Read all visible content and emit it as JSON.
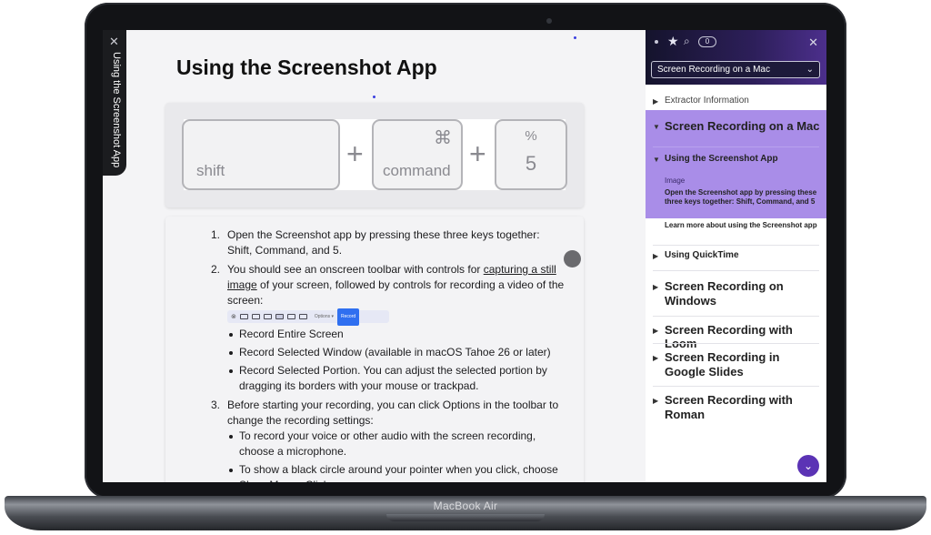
{
  "device": {
    "brand": "MacBook Air"
  },
  "side_tab": {
    "label": "Using the Screenshot App",
    "close_glyph": "✕"
  },
  "document": {
    "title": "Using the Screenshot App",
    "keys": [
      {
        "label": "shift",
        "symbol": ""
      },
      {
        "label": "command",
        "symbol": "⌘"
      },
      {
        "label": "5",
        "symbol": "%"
      }
    ],
    "plus": "+",
    "steps": [
      {
        "num": "1.",
        "text": "Open the Screenshot app by pressing these three keys together: Shift, Command, and 5."
      },
      {
        "num": "2.",
        "text_before": "You should see an onscreen toolbar with controls for ",
        "link": "capturing a still image",
        "text_after": " of your screen, followed by controls for recording a video of the screen:"
      },
      {
        "num": "3.",
        "text": "Before starting your recording, you can click Options in the toolbar to change the recording settings:"
      }
    ],
    "toolbar_mini": {
      "options_label": "Options ▾",
      "record_label": "Record"
    },
    "step2_bullets": [
      "Record Entire Screen",
      "Record Selected Window (available in macOS Tahoe 26 or later)",
      "Record Selected Portion. You can adjust the selected portion by dragging its borders with your mouse or trackpad."
    ],
    "step3_bullets": [
      "To record your voice or other audio with the screen recording, choose a microphone.",
      "To show a black circle around your pointer when you click, choose Show Mouse Clicks."
    ]
  },
  "panel": {
    "badge_count": "0",
    "select_value": "Screen Recording on a Mac",
    "toc": {
      "extractor": "Extractor Information",
      "section_active": "Screen Recording on a Mac",
      "sub_active": "Using the Screenshot App",
      "image_label": "Image",
      "image_desc": "Open the Screenshot app by pressing these three keys together: Shift, Command, and 5",
      "learn_more": "Learn more about using the Screenshot app",
      "quicktime": "Using QuickTime",
      "windows": "Screen Recording on Windows",
      "loom": "Screen Recording with Loom",
      "google": "Screen Recording in Google Slides",
      "roman": "Screen Recording with Roman"
    }
  },
  "colors": {
    "accent": "#a98de8",
    "fab": "#5b33b5"
  }
}
